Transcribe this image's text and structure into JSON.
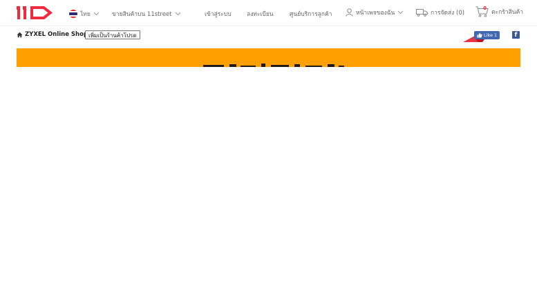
{
  "header": {
    "logo_text": "11st",
    "language": {
      "label": "ไทย",
      "flag_icon": "thailand-flag-icon"
    },
    "sell_label": "ขายสินค้าบน 11street",
    "login_label": "เข้าสู่ระบบ",
    "register_label": "ลงทะเบียน",
    "support_label": "ศูนย์บริการลูกค้า",
    "my_page_label": "หน้าเพจของฉัน",
    "shipping_label": "การจัดส่ง (0)",
    "cart": {
      "count": "0",
      "label": "ตะกร้าสินค้า"
    }
  },
  "shop": {
    "name": "ZYXEL Online Shop",
    "favorite_button": "เพิ่มเป็นร้านค้าโปรด",
    "like_button": "Like 1",
    "facebook_icon": "f"
  },
  "colors": {
    "brand_red": "#ef2a3d",
    "banner_orange": "#ff9f00",
    "facebook_blue": "#4267b2"
  }
}
